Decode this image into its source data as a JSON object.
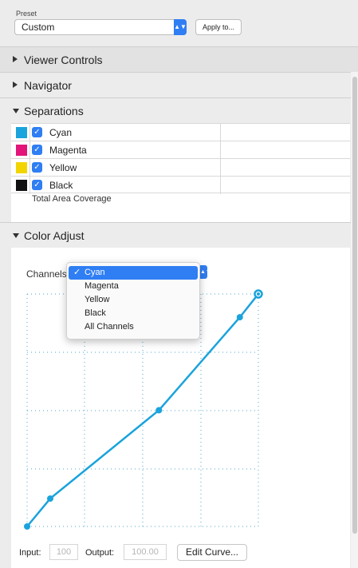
{
  "preset": {
    "label": "Preset",
    "value": "Custom",
    "apply_label": "Apply to..."
  },
  "sections": {
    "viewer_controls": "Viewer Controls",
    "navigator": "Navigator",
    "separations": "Separations",
    "color_adjust": "Color Adjust"
  },
  "separations": {
    "rows": [
      {
        "name": "Cyan",
        "color": "#1aa3dc",
        "checked": true
      },
      {
        "name": "Magenta",
        "color": "#e3157a",
        "checked": true
      },
      {
        "name": "Yellow",
        "color": "#f2d500",
        "checked": true
      },
      {
        "name": "Black",
        "color": "#111111",
        "checked": true
      }
    ],
    "total_area_coverage": "Total Area Coverage"
  },
  "channels": {
    "label": "Channels",
    "options": [
      "Cyan",
      "Magenta",
      "Yellow",
      "Black",
      "All Channels"
    ],
    "selected": "Cyan"
  },
  "curve": {
    "color": "#1aa3dc",
    "points": [
      [
        0,
        0
      ],
      [
        10,
        12
      ],
      [
        57,
        50
      ],
      [
        92,
        90
      ],
      [
        100,
        100
      ]
    ]
  },
  "footer": {
    "input_label": "Input:",
    "input_value": "100",
    "output_label": "Output:",
    "output_value": "100.00",
    "edit_curve_label": "Edit Curve..."
  },
  "colors": {
    "accent": "#2f7ef3"
  }
}
